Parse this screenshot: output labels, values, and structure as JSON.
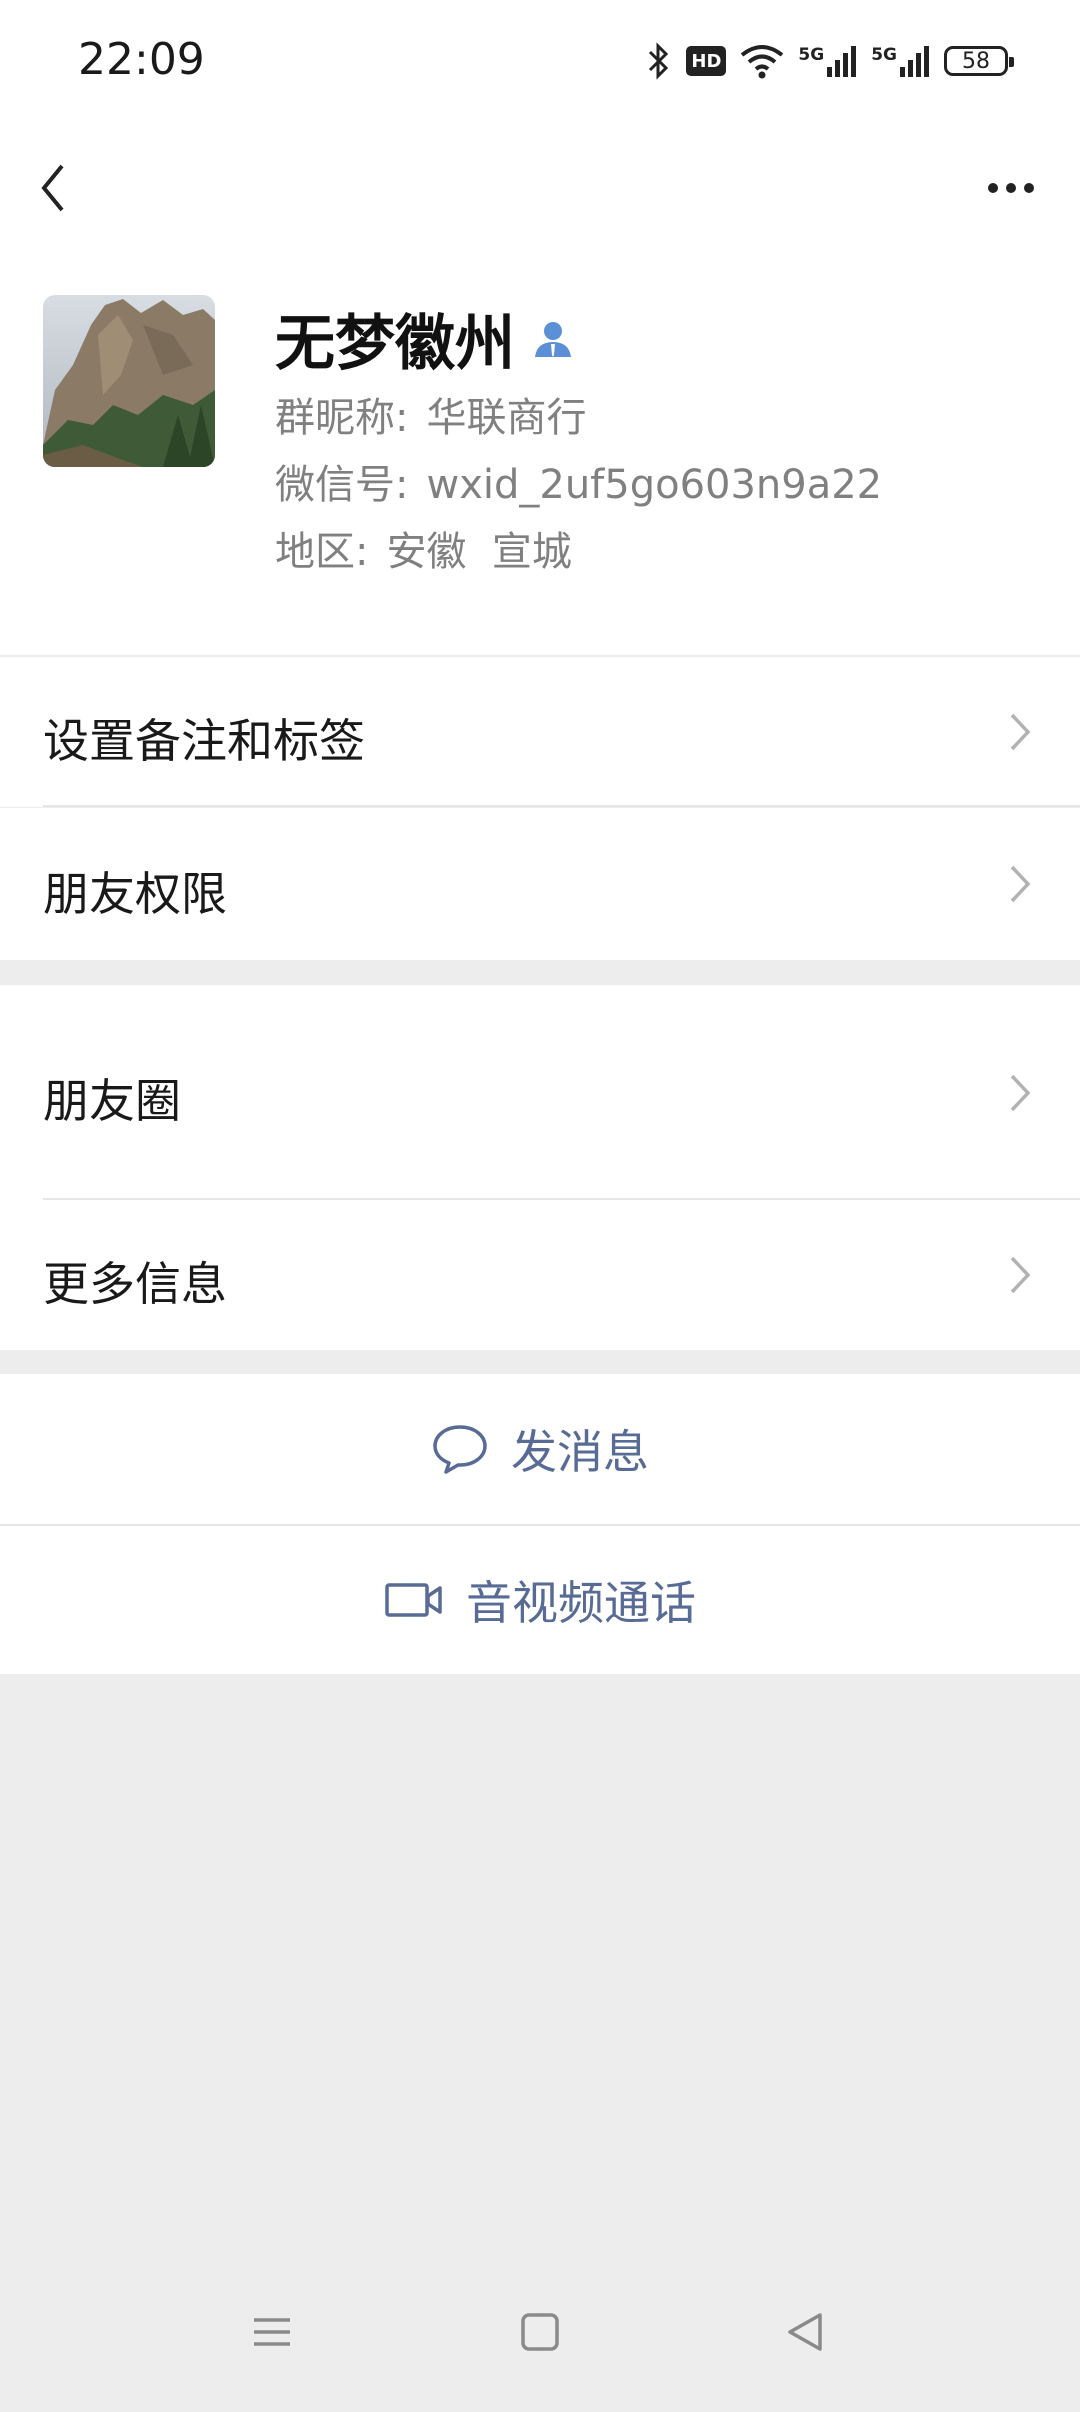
{
  "status_bar": {
    "time": "22:09",
    "battery": "58",
    "network_left": "5G",
    "network_right": "5G",
    "hd": "HD"
  },
  "profile": {
    "name": "无梦徽州",
    "group_nickname_label": "群昵称:",
    "group_nickname": "华联商行",
    "wechat_id_label": "微信号:",
    "wechat_id": "wxid_2uf5go603n9a22",
    "region_label": "地区:",
    "region": "安徽  宣城"
  },
  "menu": {
    "set_remark": "设置备注和标签",
    "friend_permissions": "朋友权限",
    "moments": "朋友圈",
    "more_info": "更多信息"
  },
  "actions": {
    "send_message": "发消息",
    "video_call": "音视频通话"
  },
  "colors": {
    "link": "#576b95",
    "background": "#ededed",
    "icon_blue": "#5b8fd6"
  }
}
